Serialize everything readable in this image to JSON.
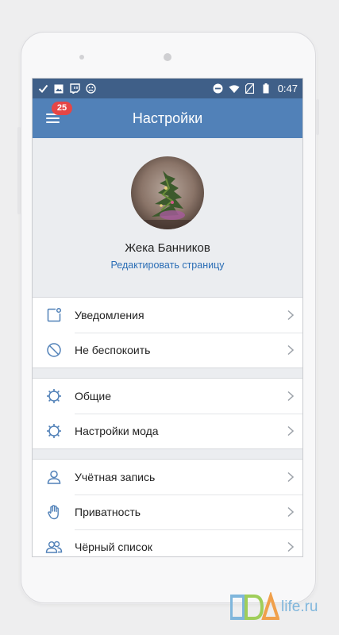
{
  "statusbar": {
    "time": "0:47",
    "left_icons": [
      "check-icon",
      "image-icon",
      "twitch-icon",
      "smiley-icon"
    ],
    "right_icons": [
      "do-not-disturb-icon",
      "wifi-icon",
      "no-sim-icon",
      "battery-icon"
    ]
  },
  "header": {
    "title": "Настройки",
    "badge_count": "25",
    "color": "#5181b8"
  },
  "profile": {
    "name": "Жека Банников",
    "edit_link": "Редактировать страницу"
  },
  "groups": [
    {
      "items": [
        {
          "label": "Уведомления",
          "icon": "notification-icon"
        },
        {
          "label": "Не беспокоить",
          "icon": "do-not-disturb-icon"
        }
      ]
    },
    {
      "items": [
        {
          "label": "Общие",
          "icon": "gear-icon"
        },
        {
          "label": "Настройки мода",
          "icon": "gear-icon"
        }
      ]
    },
    {
      "items": [
        {
          "label": "Учётная запись",
          "icon": "user-icon"
        },
        {
          "label": "Приватность",
          "icon": "hand-icon"
        },
        {
          "label": "Чёрный список",
          "icon": "users-icon"
        }
      ]
    }
  ],
  "watermark": {
    "logo_text": "PDA",
    "suffix": "life.ru"
  }
}
